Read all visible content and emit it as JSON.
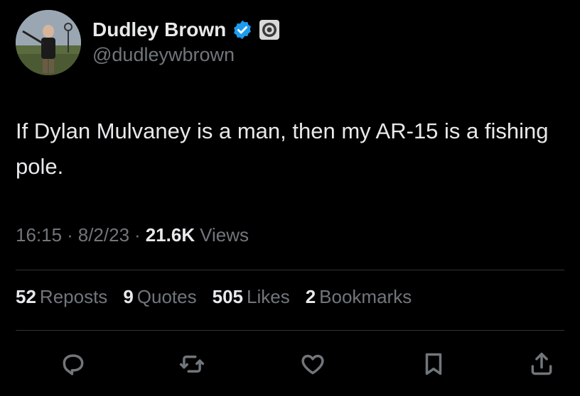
{
  "author": {
    "display_name": "Dudley Brown",
    "handle": "@dudleywbrown",
    "verified_icon": "verified-badge-icon",
    "affiliation_icon": "affiliation-badge-icon",
    "avatar_icon": "avatar-photo"
  },
  "tweet": {
    "text": "If Dylan Mulvaney is a man, then my AR-15 is a fishing pole.",
    "time": "16:15",
    "date": "8/2/23",
    "separator": "·",
    "views_count": "21.6K",
    "views_label": "Views"
  },
  "stats": [
    {
      "count": "52",
      "label": "Reposts"
    },
    {
      "count": "9",
      "label": "Quotes"
    },
    {
      "count": "505",
      "label": "Likes"
    },
    {
      "count": "2",
      "label": "Bookmarks"
    }
  ],
  "actions": [
    {
      "name": "reply",
      "icon": "reply-icon"
    },
    {
      "name": "repost",
      "icon": "repost-icon"
    },
    {
      "name": "like",
      "icon": "heart-icon"
    },
    {
      "name": "bookmark",
      "icon": "bookmark-icon"
    },
    {
      "name": "share",
      "icon": "share-icon"
    }
  ],
  "colors": {
    "background": "#000000",
    "primary_text": "#e7e9ea",
    "secondary_text": "#71767b",
    "divider": "#2f3336",
    "verified_blue": "#1d9bf0"
  }
}
